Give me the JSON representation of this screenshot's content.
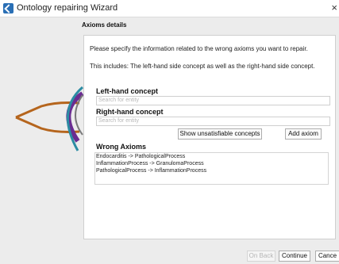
{
  "window": {
    "title": "Ontology repairing Wizard",
    "close_glyph": "×"
  },
  "section": {
    "heading": "Axioms details"
  },
  "intro": {
    "line1": "Please specify the information related to the wrong axioms you want to repair.",
    "line2": "This includes: The left-hand side concept as well as the right-hand side concept."
  },
  "left_concept": {
    "label": "Left-hand concept",
    "placeholder": "Search for entity"
  },
  "right_concept": {
    "label": "Right-hand concept",
    "placeholder": "Search for entity"
  },
  "actions": {
    "show_unsat": "Show unsatisfiable concepts",
    "add_axiom": "Add axiom"
  },
  "wrong_axioms": {
    "label": "Wrong Axioms",
    "items": [
      "Endocarditis -> PathologicalProcess",
      "InflammationProcess -> GranulomaProcess",
      "PathologicalProcess -> InflammationProcess"
    ]
  },
  "footer": {
    "back": "On Back",
    "continue": "Continue",
    "cancel": "Cance"
  },
  "background": {
    "watermark": "protege"
  },
  "colors": {
    "logo_orange": "#b5651d",
    "logo_purple": "#6a2c91",
    "logo_teal": "#2b8ca3",
    "logo_grey": "#7a7a7a"
  }
}
